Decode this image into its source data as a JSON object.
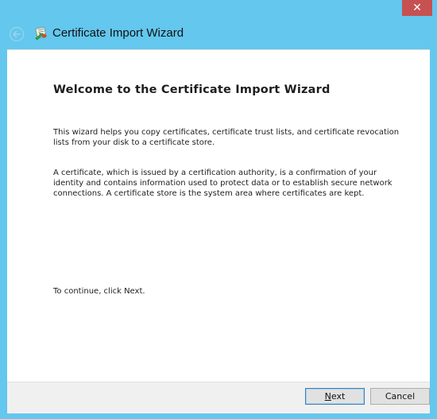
{
  "window": {
    "title": "Certificate Import Wizard",
    "close_label": "✕",
    "frame_color": "#63c7ee",
    "close_color": "#c75050"
  },
  "icons": {
    "back": "back-arrow-icon",
    "app": "certificate-icon",
    "close": "close-icon"
  },
  "main": {
    "heading": "Welcome to the Certificate Import Wizard",
    "intro": "This wizard helps you copy certificates, certificate trust lists, and certificate revocation lists from your disk to a certificate store.",
    "description": "A certificate, which is issued by a certification authority, is a confirmation of your identity and contains information used to protect data or to establish secure network connections. A certificate store is the system area where certificates are kept.",
    "continue_text": "To continue, click Next."
  },
  "footer": {
    "next_label": "Next",
    "cancel_label": "Cancel"
  }
}
